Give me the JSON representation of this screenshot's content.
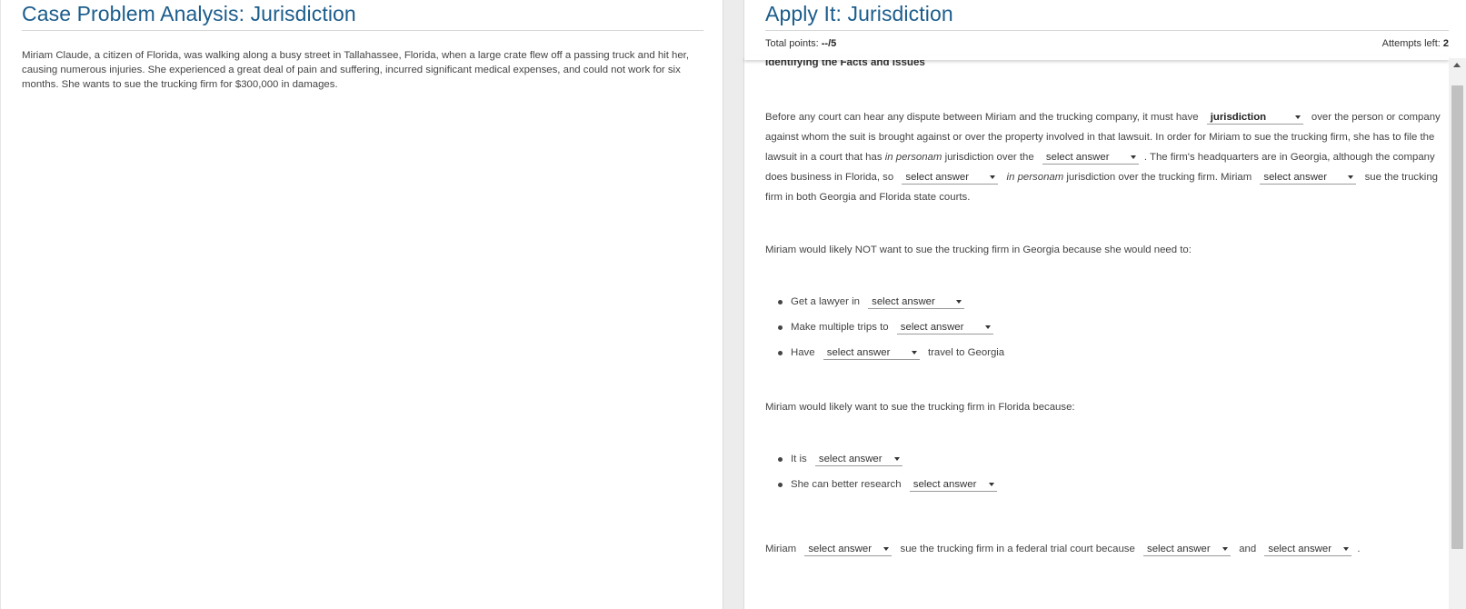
{
  "left": {
    "title": "Case Problem Analysis: Jurisdiction",
    "body": "Miriam Claude, a citizen of Florida, was walking along a busy street in Tallahassee, Florida, when a large crate flew off a passing truck and hit her, causing numerous injuries. She experienced a great deal of pain and suffering, incurred significant medical expenses, and could not work for six months. She wants to sue the trucking firm for $300,000 in damages."
  },
  "right": {
    "title": "Apply It: Jurisdiction",
    "score": {
      "points_label": "Total points: ",
      "points_value": "--/5",
      "attempts_label": "Attempts left: ",
      "attempts_value": "2"
    },
    "section_heading": "Identifying the Facts and Issues",
    "p1": {
      "t1": "Before any court can hear any dispute between Miriam and the trucking company, it must have",
      "dd1": "jurisdiction",
      "t2": "over the person or company against whom the suit is brought against or over the property involved in that lawsuit. In order for Miriam to sue the trucking firm, she has to file the lawsuit in a court that has",
      "t2i": "in personam",
      "t3": "jurisdiction over the",
      "dd2": "select answer",
      "t4": ". The firm's headquarters are in Georgia, although the company does business in Florida, so",
      "dd3": "select answer",
      "t5i": "in personam",
      "t6": "jurisdiction over the trucking firm. Miriam",
      "dd4": "select answer",
      "t7": "sue the trucking firm in both Georgia and Florida state courts."
    },
    "p2": "Miriam would likely NOT want to sue the trucking firm in Georgia because she would need to:",
    "list1": [
      {
        "pre": "Get a lawyer in",
        "dd": "select answer",
        "post": ""
      },
      {
        "pre": "Make multiple trips to",
        "dd": "select answer",
        "post": ""
      },
      {
        "pre": "Have",
        "dd": "select answer",
        "post": "travel to Georgia"
      }
    ],
    "p3": "Miriam would likely want to sue the trucking firm in Florida because:",
    "list2": [
      {
        "pre": "It is",
        "dd": "select answer"
      },
      {
        "pre": "She can better research",
        "dd": "select answer"
      }
    ],
    "p4": {
      "t1": "Miriam",
      "dd1": "select answer",
      "t2": "sue the trucking firm in a federal trial court because",
      "dd2": "select answer",
      "t3": "and",
      "dd3": "select answer",
      "t4": "."
    }
  }
}
